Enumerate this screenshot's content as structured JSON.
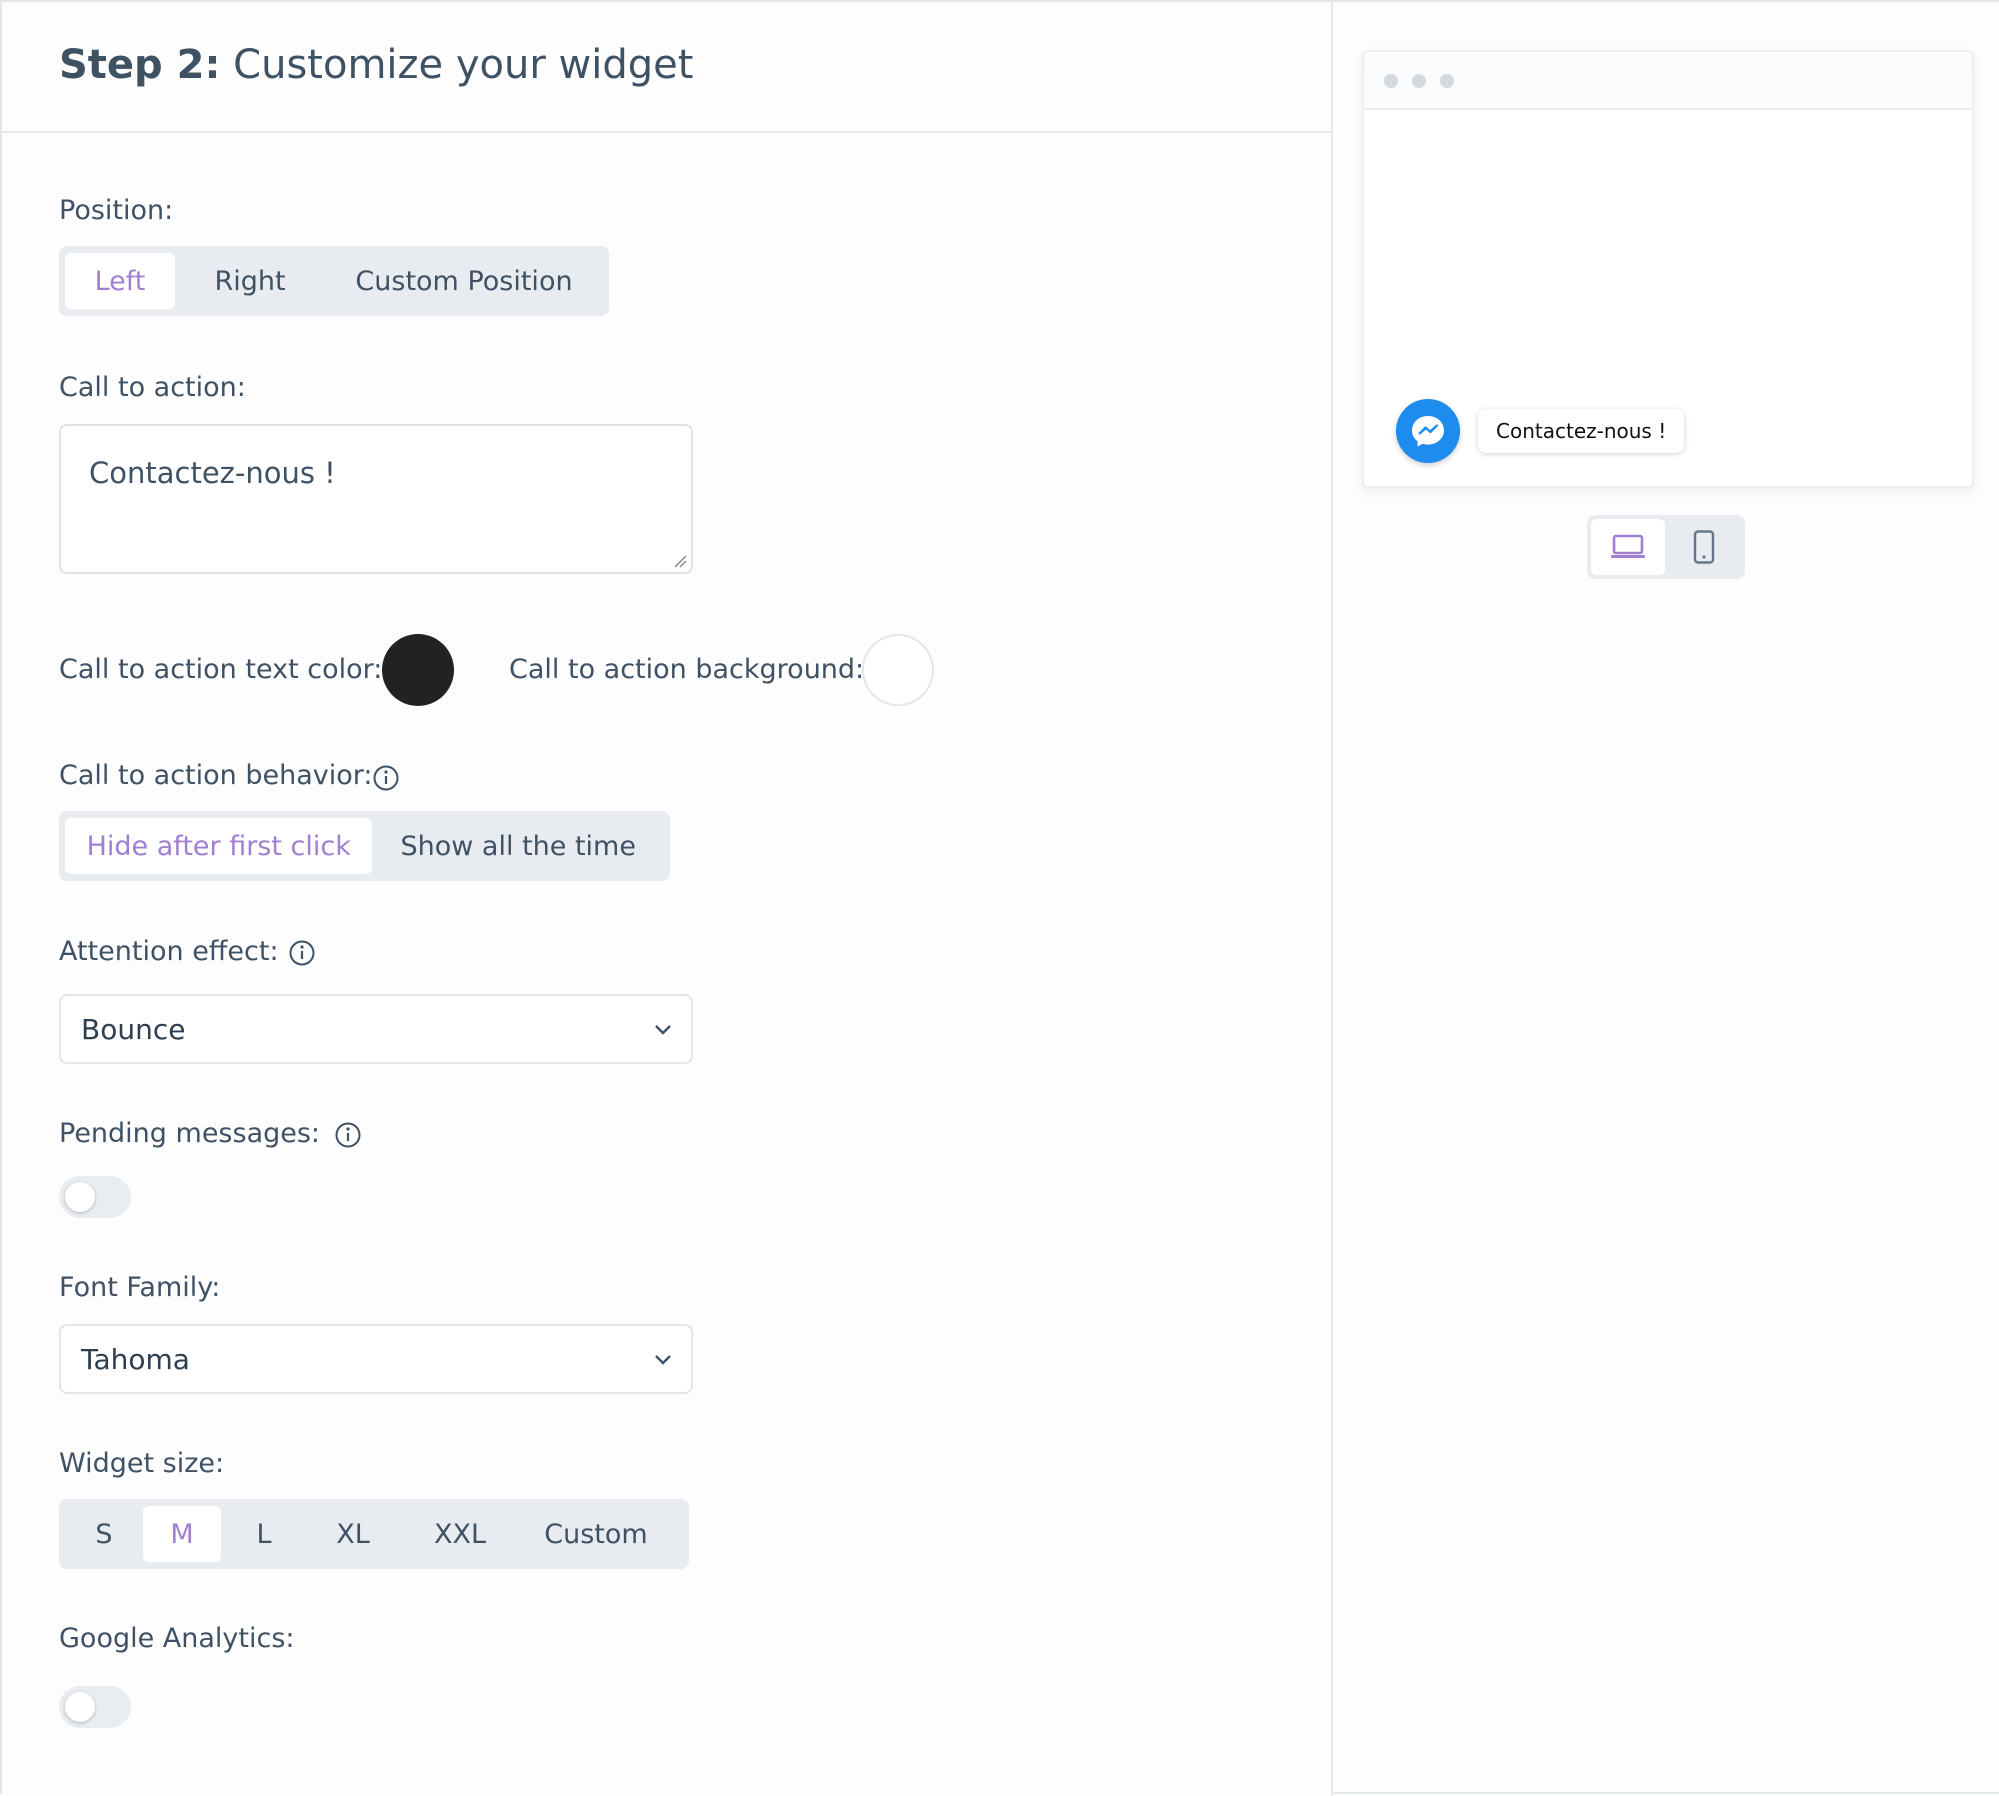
{
  "header": {
    "step_label": "Step 2:",
    "title": "Customize your widget"
  },
  "position": {
    "label": "Position:",
    "options": [
      "Left",
      "Right",
      "Custom Position"
    ],
    "selected": "Left"
  },
  "call_to_action": {
    "label": "Call to action:",
    "value": "Contactez-nous !"
  },
  "colors": {
    "text_color_label": "Call to action text color:",
    "text_color": "#222222",
    "background_label": "Call to action background:",
    "background": "#ffffff"
  },
  "behavior": {
    "label": "Call to action behavior:",
    "options": [
      "Hide after first click",
      "Show all the time"
    ],
    "selected": "Hide after first click"
  },
  "attention_effect": {
    "label": "Attention effect:",
    "value": "Bounce"
  },
  "pending_messages": {
    "label": "Pending messages:",
    "enabled": false
  },
  "font_family": {
    "label": "Font Family:",
    "value": "Tahoma"
  },
  "widget_size": {
    "label": "Widget size:",
    "options": [
      "S",
      "M",
      "L",
      "XL",
      "XXL",
      "Custom"
    ],
    "selected": "M"
  },
  "google_analytics": {
    "label": "Google Analytics:",
    "enabled": false
  },
  "preview": {
    "cta_text": "Contactez-nous !",
    "messenger_color": "#1e8cee",
    "device_selected": "desktop"
  },
  "theme": {
    "accent": "#a17fd1",
    "text": "#3f5265"
  }
}
